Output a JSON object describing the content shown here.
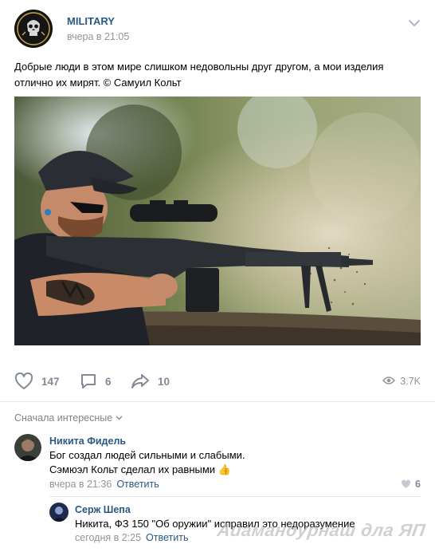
{
  "post": {
    "group_name": "MILITARY",
    "time": "вчера в 21:05",
    "text": "Добрые люди в этом мире слишком недовольны друг другом, а мои изделия отлично их мирят. © Самуил Кольт",
    "photo_icon": "photo-man-firing-rifle"
  },
  "actions": {
    "likes": "147",
    "comments": "6",
    "shares": "10",
    "views": "3.7K",
    "like_icon": "heart-icon",
    "comment_icon": "comment-icon",
    "share_icon": "share-icon",
    "views_icon": "eye-icon"
  },
  "comments_header": {
    "sort_label": "Сначала интересные"
  },
  "comments": [
    {
      "author": "Никита Фидель",
      "line1": "Бог создал людей сильными и слабыми.",
      "line2": "Сэмюэл Кольт сделал их равными",
      "emoji": "👍",
      "time": "вчера в 21:36",
      "reply_label": "Ответить",
      "likes": "6"
    },
    {
      "author": "Серж Шепа",
      "line1": "Никита, ФЗ 150 \"Об оружии\" исправил это недоразумение",
      "time": "сегодня в 2:25",
      "reply_label": "Ответить"
    }
  ],
  "watermark": "Аиамандурнаш дла ЯП",
  "colors": {
    "link": "#2a5885",
    "muted": "#939393",
    "icon": "#828a99",
    "divider": "#e7e8ec"
  }
}
